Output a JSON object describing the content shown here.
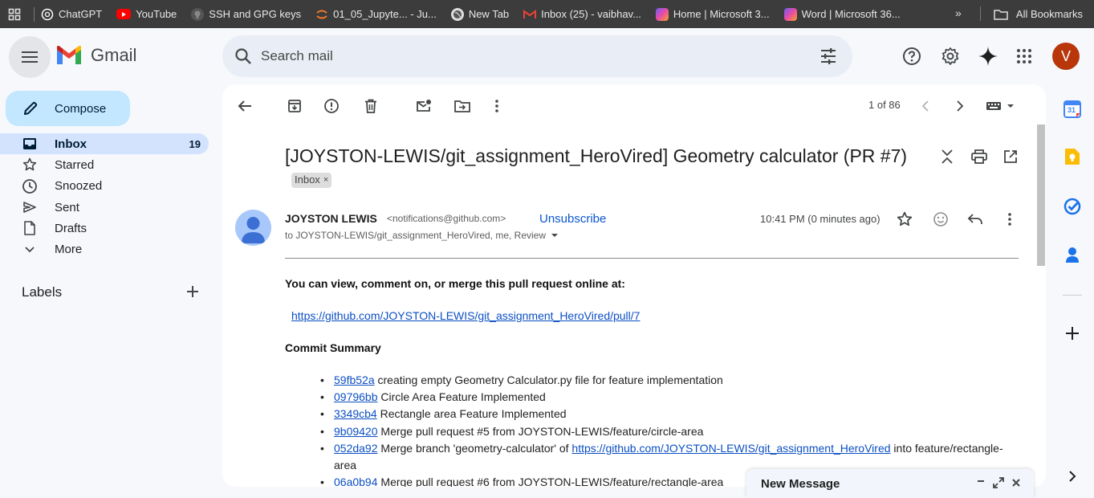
{
  "bookmarks": {
    "items": [
      {
        "label": "ChatGPT",
        "icon": "chatgpt-icon"
      },
      {
        "label": "YouTube",
        "icon": "youtube-icon"
      },
      {
        "label": "SSH and GPG keys",
        "icon": "github-icon"
      },
      {
        "label": "01_05_Jupyte... - Ju...",
        "icon": "jupyter-icon"
      },
      {
        "label": "New Tab",
        "icon": "globe-icon"
      },
      {
        "label": "Inbox (25) - vaibhav...",
        "icon": "gmail-icon"
      },
      {
        "label": "Home | Microsoft 3...",
        "icon": "microsoft-icon"
      },
      {
        "label": "Word | Microsoft 36...",
        "icon": "microsoft-icon"
      }
    ],
    "more": "»",
    "all_bookmarks": "All Bookmarks"
  },
  "header": {
    "app_name": "Gmail",
    "search_placeholder": "Search mail",
    "avatar_letter": "V"
  },
  "sidebar": {
    "compose_label": "Compose",
    "items": [
      {
        "label": "Inbox",
        "count": "19",
        "icon": "inbox-icon",
        "active": true
      },
      {
        "label": "Starred",
        "count": "",
        "icon": "star-icon"
      },
      {
        "label": "Snoozed",
        "count": "",
        "icon": "clock-icon"
      },
      {
        "label": "Sent",
        "count": "",
        "icon": "send-icon"
      },
      {
        "label": "Drafts",
        "count": "",
        "icon": "draft-icon"
      },
      {
        "label": "More",
        "count": "",
        "icon": "chevron-down-icon"
      }
    ],
    "labels_heading": "Labels"
  },
  "toolbar": {
    "pager": "1 of 86"
  },
  "email": {
    "subject": "[JOYSTON-LEWIS/git_assignment_HeroVired] Geometry calculator (PR #7)",
    "label_chip": "Inbox",
    "label_chip_close": "×",
    "sender_name": "JOYSTON LEWIS",
    "sender_email": "<notifications@github.com>",
    "unsubscribe": "Unsubscribe",
    "to_line": "to JOYSTON-LEWIS/git_assignment_HeroVired, me, Review",
    "timestamp": "10:41 PM (0 minutes ago)",
    "body": {
      "intro": "You can view, comment on, or merge this pull request online at:",
      "pr_link": "https://github.com/JOYSTON-LEWIS/git_assignment_HeroVired/pull/7",
      "commit_heading": "Commit Summary",
      "commits": [
        {
          "sha": "59fb52a",
          "text": " creating empty Geometry Calculator.py file for feature implementation"
        },
        {
          "sha": "09796bb",
          "text": " Circle Area Feature Implemented"
        },
        {
          "sha": "3349cb4",
          "text": " Rectangle area Feature Implemented"
        },
        {
          "sha": "9b09420",
          "text": " Merge pull request #5 from JOYSTON-LEWIS/feature/circle-area"
        },
        {
          "sha": "052da92",
          "text": " Merge branch 'geometry-calculator' of ",
          "link": "https://github.com/JOYSTON-LEWIS/git_assignment_HeroVired",
          "after": " into feature/rectangle-area"
        },
        {
          "sha": "06a0b94",
          "text": " Merge pull request #6 from JOYSTON-LEWIS/feature/rectangle-area"
        }
      ]
    }
  },
  "new_message": {
    "title": "New Message"
  },
  "side_panel": {
    "calendar_day": "31"
  },
  "colors": {
    "compose_bg": "#c2e7ff",
    "active_nav_bg": "#d3e3fd",
    "avatar_bg": "#b8360a",
    "link": "#0b4fc4"
  }
}
